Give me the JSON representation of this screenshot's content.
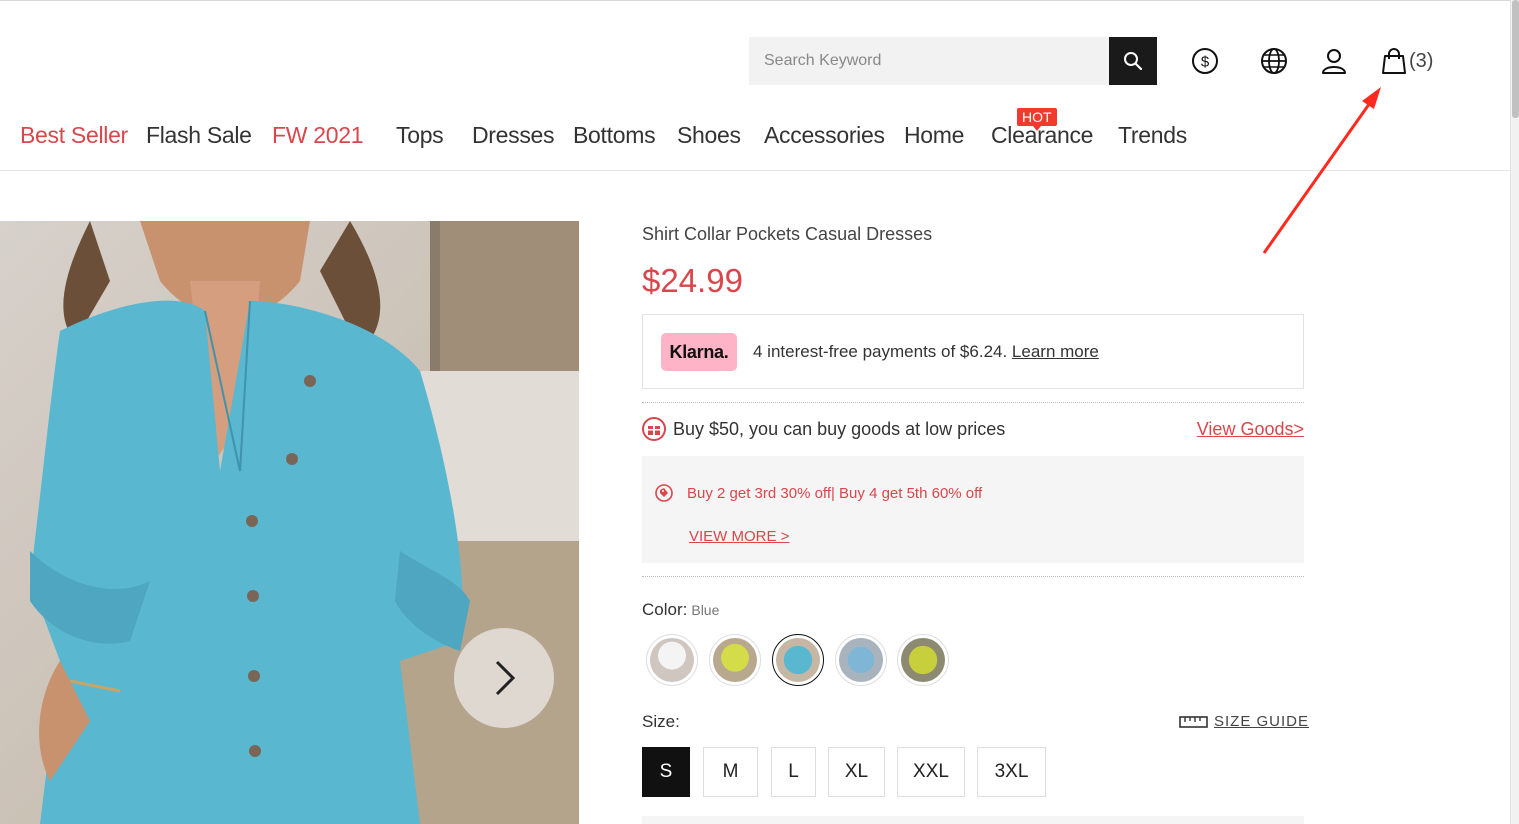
{
  "header": {
    "search_placeholder": "Search Keyword",
    "cart_count": "(3)"
  },
  "nav": {
    "items": [
      {
        "label": "Best Seller",
        "color": "#d9464b"
      },
      {
        "label": "Flash Sale"
      },
      {
        "label": "FW 2021",
        "color": "#d9464b"
      },
      {
        "label": "Tops"
      },
      {
        "label": "Dresses"
      },
      {
        "label": "Bottoms"
      },
      {
        "label": "Shoes"
      },
      {
        "label": "Accessories"
      },
      {
        "label": "Home"
      },
      {
        "label": "Clearance",
        "badge": "HOT"
      },
      {
        "label": "Trends"
      }
    ]
  },
  "product": {
    "title": "Shirt Collar Pockets Casual Dresses",
    "price": "$24.99",
    "klarna": {
      "logo": "Klarna.",
      "text": "4 interest-free payments of $6.24. ",
      "link": "Learn more"
    },
    "promo": {
      "text": "Buy $50, you can buy goods at low prices",
      "link": "View Goods>"
    },
    "offer": {
      "text": "Buy 2 get 3rd 30% off| Buy 4 get 5th 60% off",
      "more": "VIEW MORE >"
    },
    "color": {
      "label": "Color:",
      "value": "Blue",
      "swatches": [
        "White",
        "Yellow",
        "Blue",
        "Blue Striped",
        "Yellow Print"
      ]
    },
    "size": {
      "label": "Size:",
      "guide": "SIZE GUIDE",
      "options": [
        "S",
        "M",
        "L",
        "XL",
        "XXL",
        "3XL"
      ],
      "selected": "S"
    }
  },
  "colors": {
    "accent": "#d9464b",
    "klarna_pink": "#ffb3c7",
    "annotation_arrow": "#ff2a1f"
  }
}
